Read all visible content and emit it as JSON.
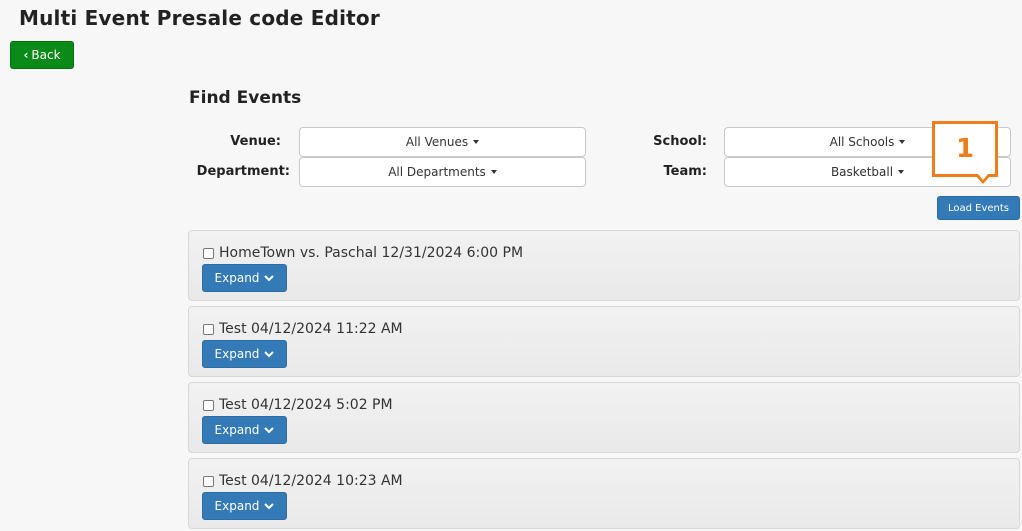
{
  "page": {
    "title": "Multi Event Presale code Editor",
    "back_label": "Back"
  },
  "find_events": {
    "title": "Find Events",
    "filters": {
      "venue": {
        "label": "Venue:",
        "value": "All Venues"
      },
      "department": {
        "label": "Department:",
        "value": "All Departments"
      },
      "school": {
        "label": "School:",
        "value": "All Schools"
      },
      "team": {
        "label": "Team:",
        "value": "Basketball"
      }
    },
    "load_label": "Load Events"
  },
  "callout": {
    "number": "1",
    "color": "#f07d1a"
  },
  "events": [
    {
      "name": "HomeTown vs. Paschal 12/31/2024 6:00 PM",
      "expand_label": "Expand"
    },
    {
      "name": "Test 04/12/2024 11:22 AM",
      "expand_label": "Expand"
    },
    {
      "name": "Test 04/12/2024 5:02 PM",
      "expand_label": "Expand"
    },
    {
      "name": "Test 04/12/2024 10:23 AM",
      "expand_label": "Expand"
    }
  ],
  "colors": {
    "back_button": "#0a8a17",
    "primary_button": "#337ab7"
  }
}
